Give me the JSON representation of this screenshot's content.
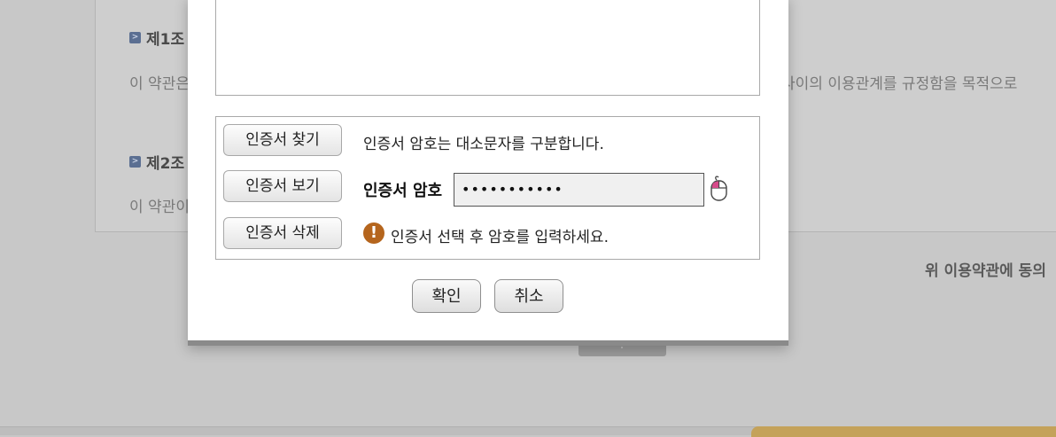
{
  "background": {
    "article1_heading": "제1조",
    "article1_text_left": "이 약관은",
    "article1_text_right": "사이의 이용관계를 규정함을 목적으로",
    "article2_heading": "제2조",
    "article2_text_left": "이 약관이",
    "agree_text": "위 이용약관에 동의",
    "marker_glyph": ">"
  },
  "dialog": {
    "buttons": {
      "find_cert": "인증서 찾기",
      "view_cert": "인증서 보기",
      "delete_cert": "인증서 삭제"
    },
    "case_note": "인증서 암호는 대소문자를 구분합니다.",
    "password_label": "인증서 암호",
    "password_value": "•••••••••••",
    "warning_text": "인증서 선택 후 암호를 입력하세요.",
    "warning_glyph": "!",
    "confirm": "확인",
    "cancel": "취소"
  },
  "colors": {
    "warning_icon": "#b5651d",
    "overlay_background": "#c8c8c8",
    "accent_yellow": "#c4a25a"
  },
  "icons": {
    "virtual_keyboard": "mouse-icon",
    "warning": "exclamation-circle-icon"
  }
}
